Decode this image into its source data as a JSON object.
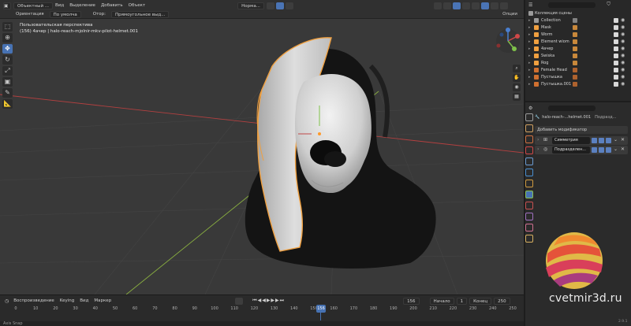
{
  "header": {
    "mode": "Объектный ...",
    "menu": [
      "Вид",
      "Выделение",
      "Добавить",
      "Объект"
    ],
    "row2": {
      "orientation_label": "Ориентация",
      "orientation_value": "По умолча",
      "snap_label": "Отор:",
      "snap_value": "Прямоугольное выд...",
      "transform_value": "Норма..."
    },
    "options": "Опции"
  },
  "viewport": {
    "view_name": "Пользовательская перспектива",
    "object_info": "(156) 4ачер | halo-reach-mjolnir-mkv-pilot-helmet.001"
  },
  "timeline": {
    "menu": [
      "Воспроизведение",
      "Keying",
      "Вид",
      "Маркер"
    ],
    "current_frame": "156",
    "start_label": "Начало",
    "start_value": "1",
    "end_label": "Конец",
    "end_value": "250",
    "ticks": [
      "0",
      "10",
      "20",
      "30",
      "40",
      "50",
      "60",
      "70",
      "80",
      "90",
      "100",
      "110",
      "120",
      "130",
      "140",
      "150",
      "160",
      "170",
      "180",
      "190",
      "200",
      "210",
      "220",
      "230",
      "240",
      "250"
    ],
    "playhead_label": "156",
    "status_left": "Axis Snap",
    "version": "2.9.1"
  },
  "outliner": {
    "title": "Коллекция сцены",
    "items": [
      {
        "label": "Collection",
        "color": "#9a9a9a"
      },
      {
        "label": "Mask",
        "color": "#f0a040"
      },
      {
        "label": "Worm",
        "color": "#f0a040"
      },
      {
        "label": "Element wiom",
        "color": "#f0a040"
      },
      {
        "label": "4ачер",
        "color": "#f0a040"
      },
      {
        "label": "Swiska",
        "color": "#f0a040"
      },
      {
        "label": "Rog",
        "color": "#f0a040"
      },
      {
        "label": "Female Head",
        "color": "#d07030"
      },
      {
        "label": "Пустышка",
        "color": "#d07030"
      },
      {
        "label": "Пустышка.001",
        "color": "#d07030"
      }
    ]
  },
  "properties": {
    "object_name": "halo-reach-...helmet.001",
    "modifier_tab": "Подразд...",
    "add_modifier": "Добавить модификатор",
    "modifiers": [
      {
        "name": "Симметрия"
      },
      {
        "name": "Подразделен..."
      }
    ]
  },
  "watermark": {
    "text": "cvetmir3d.ru"
  },
  "colors": {
    "accent": "#4772b3",
    "selection_outline": "#f0a040",
    "axis_x": "#b34040",
    "axis_y": "#8ab040"
  }
}
